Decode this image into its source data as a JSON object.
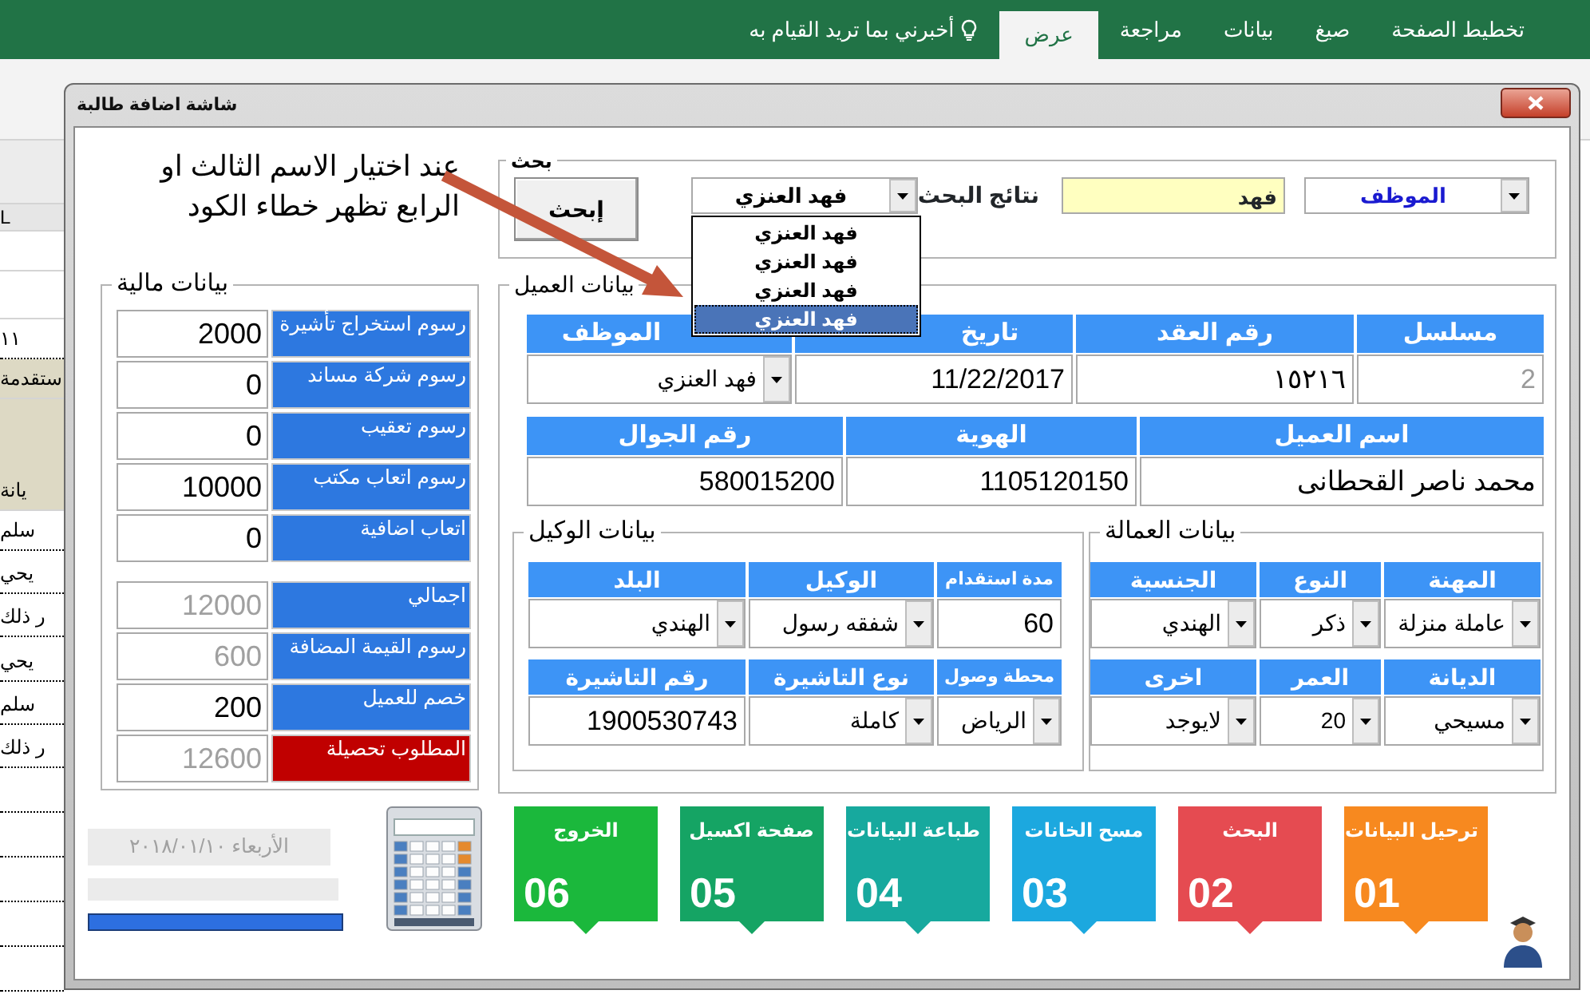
{
  "excel": {
    "ribbon_tabs": [
      {
        "label": "تخطيط الصفحة",
        "selected": false
      },
      {
        "label": "صيغ",
        "selected": false
      },
      {
        "label": "بيانات",
        "selected": false
      },
      {
        "label": "مراجعة",
        "selected": false
      },
      {
        "label": "عرض",
        "selected": true
      }
    ],
    "tell_me": "أخبرني بما تريد القيام به",
    "sheet_cells": [
      {
        "text": "L",
        "kind": "column_header"
      },
      {
        "text": "١١",
        "kind": "cell"
      },
      {
        "text": "ستقدمة",
        "kind": "header"
      },
      {
        "text": "يانة",
        "kind": "header"
      },
      {
        "text": "سلم",
        "kind": "cell"
      },
      {
        "text": "يحي",
        "kind": "cell"
      },
      {
        "text": "ر ذلك",
        "kind": "cell"
      },
      {
        "text": "يحي",
        "kind": "cell"
      },
      {
        "text": "سلم",
        "kind": "cell"
      },
      {
        "text": "ر ذلك",
        "kind": "cell"
      }
    ]
  },
  "dialog": {
    "title": "شاشة اضافة طالبة"
  },
  "annotation": "عند اختيار الاسم الثالث او\nالرابع تظهر خطاء الكود",
  "search": {
    "legend": "بحث",
    "field_combo": "الموظف",
    "query": "فهد",
    "results_label": "نتائج البحث",
    "results_combo": "فهد العنزي",
    "results_list": [
      {
        "label": "فهد العنزي",
        "selected": false
      },
      {
        "label": "فهد العنزي",
        "selected": false
      },
      {
        "label": "فهد العنزي",
        "selected": false
      },
      {
        "label": "فهد العنزي",
        "selected": true
      }
    ],
    "button": "إبحث"
  },
  "client": {
    "legend": "بيانات العميل",
    "contract_fields": [
      {
        "header": "مسلسل",
        "value": "2",
        "kind": "field",
        "disabled": true
      },
      {
        "header": "رقم العقد",
        "value": "١٥٢١٦",
        "kind": "field",
        "disabled": false
      },
      {
        "header": "تاريخ",
        "value": "11/22/2017",
        "kind": "field",
        "disabled": false
      },
      {
        "header": "الموظف",
        "value": "فهد العنزي",
        "kind": "combo",
        "disabled": false
      }
    ],
    "customer_fields": [
      {
        "header": "اسم العميل",
        "value": "محمد ناصر القحطانى",
        "kind": "field",
        "disabled": false
      },
      {
        "header": "الهوية",
        "value": "1105120150",
        "kind": "field",
        "disabled": false
      },
      {
        "header": "رقم الجوال",
        "value": "580015200",
        "kind": "field",
        "disabled": false
      }
    ]
  },
  "worker": {
    "legend": "بيانات العمالة",
    "rows": [
      [
        {
          "header": "المهنة",
          "value": "عاملة منزلة",
          "kind": "combo",
          "disabled": false
        },
        {
          "header": "النوع",
          "value": "ذكر",
          "kind": "combo",
          "disabled": false
        },
        {
          "header": "الجنسية",
          "value": "الهندي",
          "kind": "combo",
          "disabled": false
        }
      ],
      [
        {
          "header": "الديانة",
          "value": "مسيحي",
          "kind": "combo",
          "disabled": false
        },
        {
          "header": "العمر",
          "value": "20",
          "kind": "combo",
          "disabled": false
        },
        {
          "header": "اخرى",
          "value": "لايوجد",
          "kind": "combo",
          "disabled": false
        }
      ]
    ]
  },
  "agent": {
    "legend": "بيانات الوكيل",
    "rows": [
      [
        {
          "header": "مدة استقدام",
          "value": "60",
          "kind": "field",
          "disabled": false
        },
        {
          "header": "الوكيل",
          "value": "شفقه رسول",
          "kind": "combo",
          "disabled": false
        },
        {
          "header": "البلد",
          "value": "الهندي",
          "kind": "combo",
          "disabled": false
        }
      ],
      [
        {
          "header": "محطة وصول",
          "value": "الرياض",
          "kind": "combo",
          "disabled": false
        },
        {
          "header": "نوع التاشيرة",
          "value": "كاملة",
          "kind": "combo",
          "disabled": false
        },
        {
          "header": "رقم التاشيرة",
          "value": "1900530743",
          "kind": "field",
          "disabled": false
        }
      ]
    ]
  },
  "finance": {
    "legend": "بيانات مالية",
    "rows": [
      {
        "label": "رسوم استخراج تأشيرة",
        "value": "2000",
        "disabled": false,
        "highlight": false
      },
      {
        "label": "رسوم شركة مساند",
        "value": "0",
        "disabled": false,
        "highlight": false
      },
      {
        "label": "رسوم تعقيب",
        "value": "0",
        "disabled": false,
        "highlight": false
      },
      {
        "label": "رسوم اتعاب مكتب",
        "value": "10000",
        "disabled": false,
        "highlight": false
      },
      {
        "label": "اتعاب اضافية",
        "value": "0",
        "disabled": false,
        "highlight": false
      },
      {
        "label": "اجمالي",
        "value": "12000",
        "disabled": true,
        "highlight": false
      },
      {
        "label": "رسوم القيمة المضافة",
        "value": "600",
        "disabled": true,
        "highlight": false
      },
      {
        "label": "خصم للعميل",
        "value": "200",
        "disabled": false,
        "highlight": false
      },
      {
        "label": "المطلوب تحصيلة",
        "value": "12600",
        "disabled": true,
        "highlight": true
      }
    ]
  },
  "status": {
    "date": "الأربعاء ٢٠١٨/٠١/١٠",
    "progress": {
      "level": 1
    }
  },
  "tiles": [
    {
      "title": "ترحيل البيانات",
      "number": "01",
      "color": "#f7891f"
    },
    {
      "title": "البحث",
      "number": "02",
      "color": "#e54b51"
    },
    {
      "title": "مسح الخانات",
      "number": "03",
      "color": "#1ca8df"
    },
    {
      "title": "طباعة البيانات",
      "number": "04",
      "color": "#17a99e"
    },
    {
      "title": "صفحة اكسيل",
      "number": "05",
      "color": "#15a464"
    },
    {
      "title": "الخروج",
      "number": "06",
      "color": "#1bb83c"
    }
  ]
}
